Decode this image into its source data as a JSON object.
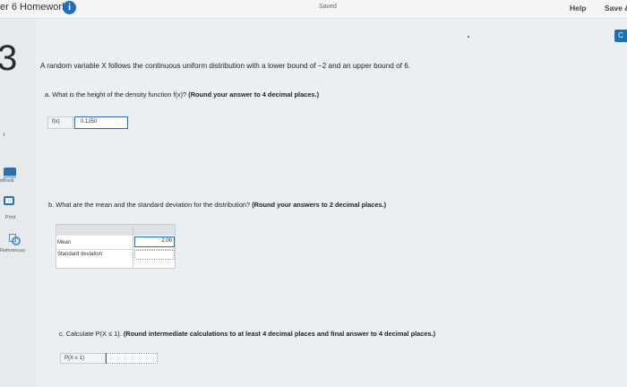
{
  "header": {
    "title": "er 6 Homework",
    "info_icon": "i",
    "status": "Saved",
    "help_label": "Help",
    "save_label": "Save &"
  },
  "sidebar": {
    "question_number": "3",
    "items": [
      {
        "label": "eBook",
        "icon": "ebook-icon"
      },
      {
        "label": "Print",
        "icon": "print-icon"
      },
      {
        "label": "References",
        "icon": "references-icon"
      }
    ]
  },
  "right_button": {
    "label": "C"
  },
  "question": {
    "prompt": "A random variable X follows the continuous uniform distribution with a lower bound of −2 and an upper bound of 6.",
    "part_a": {
      "text": "a. What is the height of the density function f(x)?",
      "instruction": "(Round your answer to 4 decimal places.)",
      "answer_label": "f(x)",
      "answer_value": "0.1250"
    },
    "part_b": {
      "text": "b. What are the mean and the standard deviation for the distribution?",
      "instruction": "(Round your answers to 2 decimal places.)",
      "rows": [
        {
          "label": "Mean",
          "value": "2.00"
        },
        {
          "label": "Standard deviation",
          "value": ""
        }
      ]
    },
    "part_c": {
      "text": "c. Calculate P(X ≤ 1).",
      "instruction": "(Round intermediate calculations to at least 4 decimal places and final answer to 4 decimal places.)",
      "answer_label": "P(X ≤ 1)",
      "answer_value": ""
    }
  }
}
